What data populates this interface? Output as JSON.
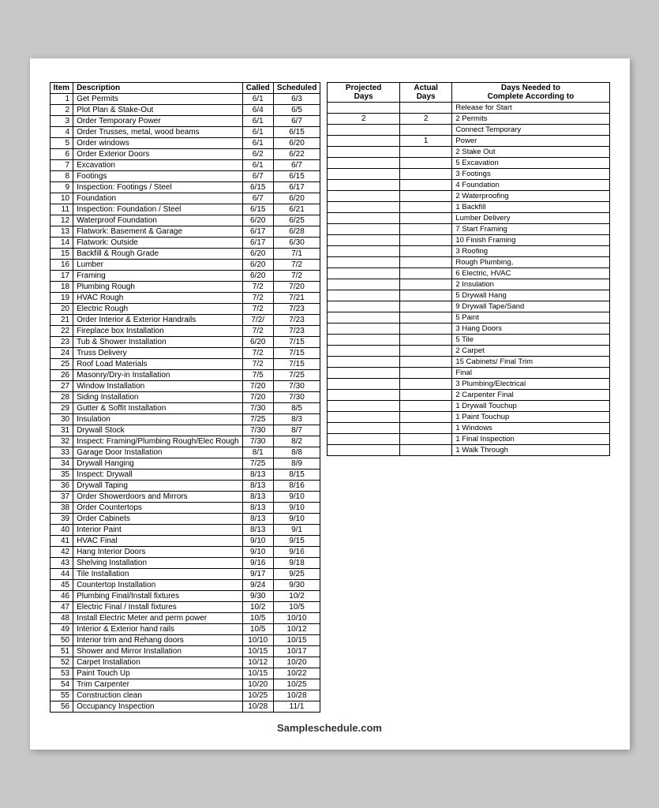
{
  "leftTable": {
    "headers": [
      "Item",
      "Description",
      "Called",
      "Scheduled"
    ],
    "rows": [
      [
        1,
        "Get Permits",
        "6/1",
        "6/3"
      ],
      [
        2,
        "Plot Plan & Stake-Out",
        "6/4",
        "6/5"
      ],
      [
        3,
        "Order Temporary Power",
        "6/1",
        "6/7"
      ],
      [
        4,
        "Order Trusses, metal, wood beams",
        "6/1",
        "6/15"
      ],
      [
        5,
        "Order windows",
        "6/1",
        "6/20"
      ],
      [
        6,
        "Order Exterior Doors",
        "6/2",
        "6/22"
      ],
      [
        7,
        "Excavation",
        "6/1",
        "6/7"
      ],
      [
        8,
        "Footings",
        "6/7",
        "6/15"
      ],
      [
        9,
        "Inspection: Footings / Steel",
        "6/15",
        "6/17"
      ],
      [
        10,
        "Foundation",
        "6/7",
        "6/20"
      ],
      [
        11,
        "Inspection: Foundation / Steel",
        "6/15",
        "6/21"
      ],
      [
        12,
        "Waterproof Foundation",
        "6/20",
        "6/25"
      ],
      [
        13,
        "Flatwork: Basement & Garage",
        "6/17",
        "6/28"
      ],
      [
        14,
        "Flatwork: Outside",
        "6/17",
        "6/30"
      ],
      [
        15,
        "Backfill & Rough Grade",
        "6/20",
        "7/1"
      ],
      [
        16,
        "Lumber",
        "6/20",
        "7/2"
      ],
      [
        17,
        "Framing",
        "6/20",
        "7/2"
      ],
      [
        18,
        "Plumbing Rough",
        "7/2",
        "7/20"
      ],
      [
        19,
        "HVAC Rough",
        "7/2",
        "7/21"
      ],
      [
        20,
        "Electric Rough",
        "7/2",
        "7/23"
      ],
      [
        21,
        "Order Interior & Exterior Handrails",
        "7/2/",
        "7/23"
      ],
      [
        22,
        "Fireplace box Installation",
        "7/2",
        "7/23"
      ],
      [
        23,
        "Tub & Shower Installation",
        "6/20",
        "7/15"
      ],
      [
        24,
        "Truss Delivery",
        "7/2",
        "7/15"
      ],
      [
        25,
        "Roof Load Materials",
        "7/2",
        "7/15"
      ],
      [
        26,
        "Masonry/Dry-in Installation",
        "7/5",
        "7/25"
      ],
      [
        27,
        "Window Installation",
        "7/20",
        "7/30"
      ],
      [
        28,
        "Siding Installation",
        "7/20",
        "7/30"
      ],
      [
        29,
        "Gutter & Soffit Installation",
        "7/30",
        "8/5"
      ],
      [
        30,
        "Insulation",
        "7/25",
        "8/3"
      ],
      [
        31,
        "Drywall Stock",
        "7/30",
        "8/7"
      ],
      [
        32,
        "Inspect: Framing/Plumbing Rough/Elec Rough",
        "7/30",
        "8/2"
      ],
      [
        33,
        "Garage Door Installation",
        "8/1",
        "8/8"
      ],
      [
        34,
        "Drywall Hanging",
        "7/25",
        "8/9"
      ],
      [
        35,
        "Inspect: Drywall",
        "8/13",
        "8/15"
      ],
      [
        36,
        "Drywall Taping",
        "8/13",
        "8/16"
      ],
      [
        37,
        "Order Showerdoors and Mirrors",
        "8/13",
        "9/10"
      ],
      [
        38,
        "Order Countertops",
        "8/13",
        "9/10"
      ],
      [
        39,
        "Order Cabinets",
        "8/13",
        "9/10"
      ],
      [
        40,
        "Interior Paint",
        "8/13",
        "9/1"
      ],
      [
        41,
        "HVAC Final",
        "9/10",
        "9/15"
      ],
      [
        42,
        "Hang Interior Doors",
        "9/10",
        "9/16"
      ],
      [
        43,
        "Shelving Installation",
        "9/16",
        "9/18"
      ],
      [
        44,
        "Tile Installation",
        "9/17",
        "9/25"
      ],
      [
        45,
        "Countertop Installation",
        "9/24",
        "9/30"
      ],
      [
        46,
        "Plumbing Final/Install fixtures",
        "9/30",
        "10/2"
      ],
      [
        47,
        "Electric Final / Install fixtures",
        "10/2",
        "10/5"
      ],
      [
        48,
        "Install Electric Meter and perm power",
        "10/5",
        "10/10"
      ],
      [
        49,
        "Interior & Exterior hand rails",
        "10/5",
        "10/12"
      ],
      [
        50,
        "Interior trim and Rehang doors",
        "10/10",
        "10/15"
      ],
      [
        51,
        "Shower and Mirror Installation",
        "10/15",
        "10/17"
      ],
      [
        52,
        "Carpet Installation",
        "10/12",
        "10/20"
      ],
      [
        53,
        "Paint Touch Up",
        "10/15",
        "10/22"
      ],
      [
        54,
        "Trim Carpenter",
        "10/20",
        "10/25"
      ],
      [
        55,
        "Construction clean",
        "10/25",
        "10/28"
      ],
      [
        56,
        "Occupancy Inspection",
        "10/28",
        "11/1"
      ]
    ]
  },
  "rightTable": {
    "headers": [
      "Projected\nDays",
      "Actual\nDays",
      "Days Needed to\nComplete According to"
    ],
    "rows": [
      [
        "",
        "",
        "Release for Start"
      ],
      [
        "2",
        "2",
        "2 Permits"
      ],
      [
        "",
        "",
        "Connect Temporary"
      ],
      [
        "",
        "1",
        "Power"
      ],
      [
        "",
        "",
        "2 Stake Out"
      ],
      [
        "",
        "",
        "5 Excavation"
      ],
      [
        "",
        "",
        "3 Footings"
      ],
      [
        "",
        "",
        "4 Foundation"
      ],
      [
        "",
        "",
        "2 Waterproofing"
      ],
      [
        "",
        "",
        "1 Backfill"
      ],
      [
        "",
        "",
        "Lumber Delivery"
      ],
      [
        "",
        "",
        "7 Start Framing"
      ],
      [
        "",
        "",
        "10 Finish Framing"
      ],
      [
        "",
        "",
        "3 Roofing"
      ],
      [
        "",
        "",
        "Rough Plumbing,"
      ],
      [
        "",
        "",
        "6 Electric, HVAC"
      ],
      [
        "",
        "",
        "2 Insulation"
      ],
      [
        "",
        "",
        "5 Drywall Hang"
      ],
      [
        "",
        "",
        "9 Drywall Tape/Sand"
      ],
      [
        "",
        "",
        "5 Paint"
      ],
      [
        "",
        "",
        "3 Hang Doors"
      ],
      [
        "",
        "",
        "5 Tile"
      ],
      [
        "",
        "",
        "2 Carpet"
      ],
      [
        "",
        "",
        "15 Cabinets/ Final Trim"
      ],
      [
        "",
        "",
        "Final"
      ],
      [
        "",
        "",
        "3 Plumbing/Electrical"
      ],
      [
        "",
        "",
        "2 Carpenter Final"
      ],
      [
        "",
        "",
        "1 Drywall Touchup"
      ],
      [
        "",
        "",
        "1 Paint Touchup"
      ],
      [
        "",
        "",
        "1 Windows"
      ],
      [
        "",
        "",
        "1 Final Inspection"
      ],
      [
        "",
        "",
        "1 Walk Through"
      ]
    ]
  },
  "website": "Sampleschedule.com"
}
